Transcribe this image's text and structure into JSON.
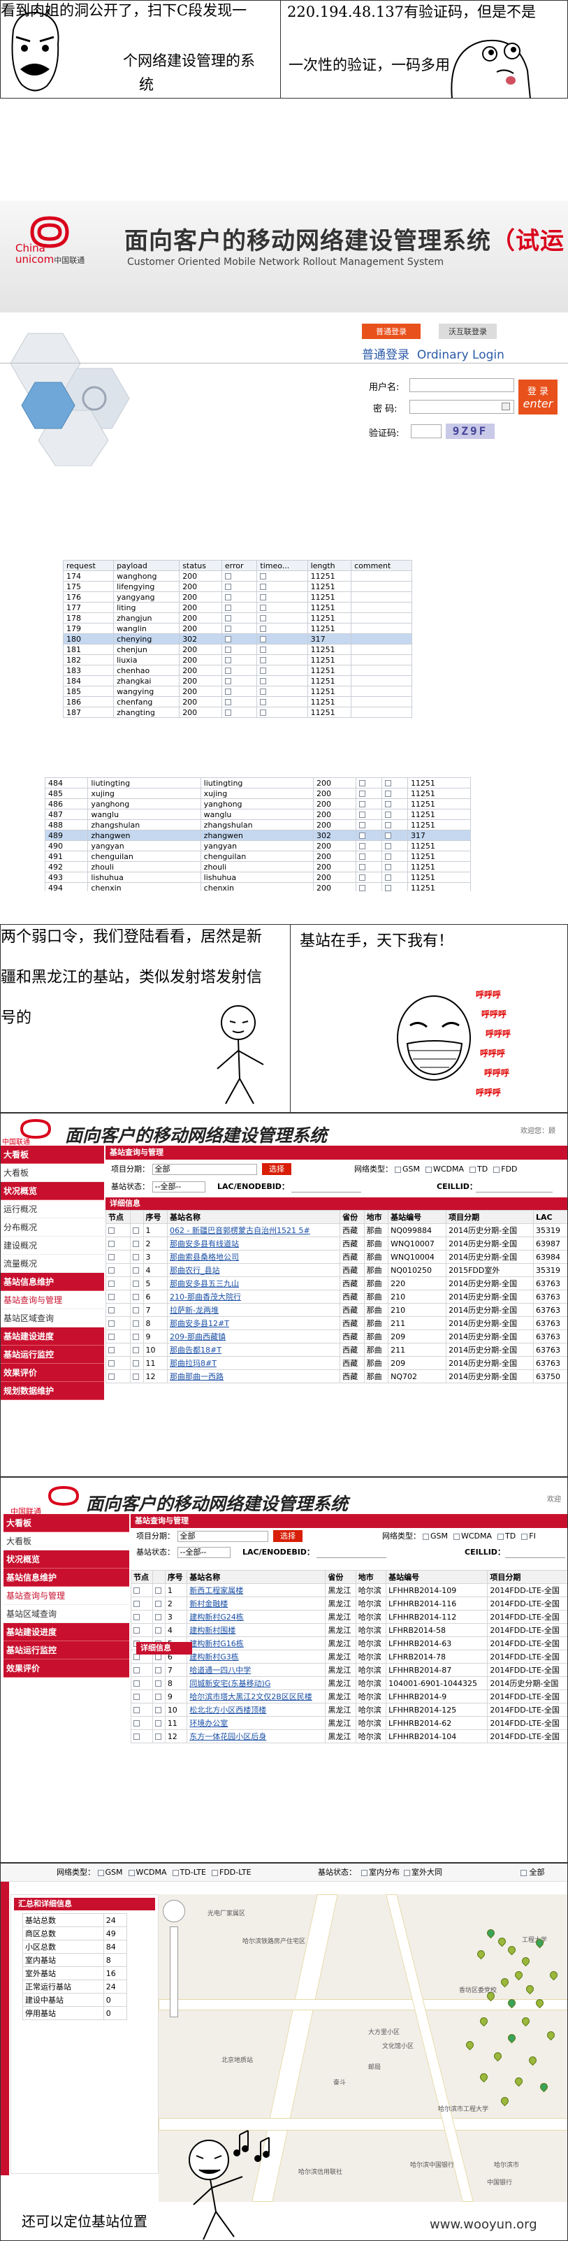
{
  "comic1": {
    "left_text": "看到肉姐的洞公开了，扫下C段发现一个网络建设管理的系统",
    "left_line1": "看到肉姐的洞公开了，扫下C段发现一",
    "left_line2": "个网络建设管理的系",
    "left_line3": "统",
    "right_line1": "220.194.48.137有验证码，但是不是",
    "right_line2": "一次性的验证，一码多用"
  },
  "login": {
    "logo_cn": "中国联通",
    "logo_en_top": "China",
    "logo_en_bottom": "unicom",
    "system_title": "面向客户的移动网络建设管理系统",
    "system_title_suffix": "（试运",
    "system_subtitle": "Customer Oriented Mobile Network Rollout Management System",
    "tab_active": "普通登录",
    "tab_other": "沃互联登录",
    "login_heading_cn": "普通登录",
    "login_heading_en": "Ordinary Login",
    "user_label": "用户名:",
    "pass_label": "密  码:",
    "captcha_label": "验证码:",
    "captcha_value": "9Z9F",
    "login_btn_cn": "登 录",
    "login_btn_en": "enter"
  },
  "burp1": {
    "headers": [
      "request",
      "payload",
      "status",
      "error",
      "timeo...",
      "length",
      "comment"
    ],
    "rows": [
      [
        "174",
        "wanghong",
        "200",
        "",
        "",
        "11251",
        ""
      ],
      [
        "175",
        "lifengying",
        "200",
        "",
        "",
        "11251",
        ""
      ],
      [
        "176",
        "yangyang",
        "200",
        "",
        "",
        "11251",
        ""
      ],
      [
        "177",
        "liting",
        "200",
        "",
        "",
        "11251",
        ""
      ],
      [
        "178",
        "zhangjun",
        "200",
        "",
        "",
        "11251",
        ""
      ],
      [
        "179",
        "wanglin",
        "200",
        "",
        "",
        "11251",
        ""
      ],
      [
        "180",
        "chenying",
        "302",
        "",
        "",
        "317",
        ""
      ],
      [
        "181",
        "chenjun",
        "200",
        "",
        "",
        "11251",
        ""
      ],
      [
        "182",
        "liuxia",
        "200",
        "",
        "",
        "11251",
        ""
      ],
      [
        "183",
        "chenhao",
        "200",
        "",
        "",
        "11251",
        ""
      ],
      [
        "184",
        "zhangkai",
        "200",
        "",
        "",
        "11251",
        ""
      ],
      [
        "185",
        "wangying",
        "200",
        "",
        "",
        "11251",
        ""
      ],
      [
        "186",
        "chenfang",
        "200",
        "",
        "",
        "11251",
        ""
      ],
      [
        "187",
        "zhangting",
        "200",
        "",
        "",
        "11251",
        ""
      ]
    ],
    "selected_index": 6
  },
  "burp2": {
    "rows": [
      [
        "484",
        "liutingting",
        "liutingting",
        "200",
        "",
        "",
        "11251"
      ],
      [
        "485",
        "xujing",
        "xujing",
        "200",
        "",
        "",
        "11251"
      ],
      [
        "486",
        "yanghong",
        "yanghong",
        "200",
        "",
        "",
        "11251"
      ],
      [
        "487",
        "wanglu",
        "wanglu",
        "200",
        "",
        "",
        "11251"
      ],
      [
        "488",
        "zhangshulan",
        "zhangshulan",
        "200",
        "",
        "",
        "11251"
      ],
      [
        "489",
        "zhangwen",
        "zhangwen",
        "302",
        "",
        "",
        "317"
      ],
      [
        "490",
        "yangyan",
        "yangyan",
        "200",
        "",
        "",
        "11251"
      ],
      [
        "491",
        "chenguilan",
        "chenguilan",
        "200",
        "",
        "",
        "11251"
      ],
      [
        "492",
        "zhouli",
        "zhouli",
        "200",
        "",
        "",
        "11251"
      ],
      [
        "493",
        "lishuhua",
        "lishuhua",
        "200",
        "",
        "",
        "11251"
      ],
      [
        "494",
        "chenxin",
        "chenxin",
        "200",
        "",
        "",
        "11251"
      ]
    ],
    "selected_index": 5
  },
  "comic2": {
    "left_line1": "两个弱口令，我们登陆看看，居然是新",
    "left_line2": "疆和黑龙江的基站，类似发射塔发射信",
    "left_line3": "号的",
    "right_line1": "基站在手，天下我有！",
    "laugh": [
      "呼呼呼",
      "呼呼呼",
      "呼呼呼",
      "呼呼呼",
      "呼呼呼",
      "呼呼呼"
    ]
  },
  "sys1": {
    "title": "面向客户的移动网络建设管理系统",
    "welcome": "欢迎您：顾",
    "sidebar": [
      "大看板",
      "大看板",
      "状况概览",
      "运行概况",
      "分布概况",
      "建设概况",
      "流量概况",
      "基站信息维护",
      "基站查询与管理",
      "基站区域查询",
      "基站建设进度",
      "基站运行监控",
      "效果评价",
      "规划数据维护"
    ],
    "panel_title": "基站查询与管理",
    "project_label": "项目分期：",
    "project_value": "全部",
    "select_btn": "选择",
    "net_label": "网络类型：",
    "net_types": [
      "GSM",
      "WCDMA",
      "TD",
      "FDD"
    ],
    "state_label": "基站状态：",
    "state_value": "--全部--",
    "lac_label": "LAC/ENODEBID：",
    "cell_label": "CEILLID：",
    "detail_title": "详细信息",
    "headers": [
      "节点",
      "",
      "序号",
      "基站名称",
      "省份",
      "地市",
      "基站编号",
      "项目分期",
      "LAC"
    ],
    "rows": [
      [
        "1",
        "062 - 新疆巴音郭楞蒙古自治州1521 5#",
        "西藏",
        "那曲",
        "NQ099884",
        "2014历史分期-全国",
        "35319"
      ],
      [
        "2",
        "那曲安多县有线道站",
        "西藏",
        "那曲",
        "WNQ10007",
        "2014历史分期-全国",
        "63987"
      ],
      [
        "3",
        "那曲索县桑格地公司",
        "西藏",
        "那曲",
        "WNQ10004",
        "2014历史分期-全国",
        "63984"
      ],
      [
        "4",
        "那曲农行_县站",
        "西藏",
        "那曲",
        "NQ010250",
        "2015FDD室外",
        "35319"
      ],
      [
        "5",
        "那曲安多县五三九山",
        "西藏",
        "那曲",
        "220",
        "2014历史分期-全国",
        "63763"
      ],
      [
        "6",
        "210-那曲香茂大院行",
        "西藏",
        "那曲",
        "210",
        "2014历史分期-全国",
        "63763"
      ],
      [
        "7",
        "拉萨新-龙两堆",
        "西藏",
        "那曲",
        "210",
        "2014历史分期-全国",
        "63763"
      ],
      [
        "8",
        "那曲安多县12#T",
        "西藏",
        "那曲",
        "211",
        "2014历史分期-全国",
        "63763"
      ],
      [
        "9",
        "209-那曲西藏镇",
        "西藏",
        "那曲",
        "209",
        "2014历史分期-全国",
        "63763"
      ],
      [
        "10",
        "那曲告都18#T",
        "西藏",
        "那曲",
        "211",
        "2014历史分期-全国",
        "63763"
      ],
      [
        "11",
        "那曲拉玛8#T",
        "西藏",
        "那曲",
        "209",
        "2014历史分期-全国",
        "63763"
      ],
      [
        "12",
        "那曲那曲一西路",
        "西藏",
        "那曲",
        "NQ702",
        "2014历史分期-全国",
        "63750"
      ]
    ]
  },
  "sys2": {
    "title": "面向客户的移动网络建设管理系统",
    "welcome": "欢迎",
    "sidebar": [
      "大看板",
      "大看板",
      "状况概览",
      "基站信息维护",
      "基站查询与管理",
      "基站区域查询",
      "基站建设进度",
      "基站运行监控",
      "效果评价"
    ],
    "panel_title": "基站查询与管理",
    "project_label": "项目分期：",
    "project_value": "全部",
    "select_btn": "选择",
    "net_label": "网络类型：",
    "net_types": [
      "GSM",
      "WCDMA",
      "TD",
      "FI"
    ],
    "state_label": "基站状态：",
    "state_value": "--全部--",
    "lac_label": "LAC/ENODEBID：",
    "cell_label": "CEILLID：",
    "detail_title": "详细信息",
    "headers": [
      "节点",
      "",
      "序号",
      "基站名称",
      "省份",
      "地市",
      "基站编号",
      "项目分期"
    ],
    "rows": [
      [
        "1",
        "新西工程家属楼",
        "黑龙江",
        "哈尔滨",
        "LFHHRB2014-109",
        "2014FDD-LTE-全国"
      ],
      [
        "2",
        "新村金融楼",
        "黑龙江",
        "哈尔滨",
        "LFHHRB2014-116",
        "2014FDD-LTE-全国"
      ],
      [
        "3",
        "建构新村G24栋",
        "黑龙江",
        "哈尔滨",
        "LFHHRB2014-112",
        "2014FDD-LTE-全国"
      ],
      [
        "4",
        "建构新村围楼",
        "黑龙江",
        "哈尔滨",
        "LFHRB2014-58",
        "2014FDD-LTE-全国"
      ],
      [
        "5",
        "建构新村G16栋",
        "黑龙江",
        "哈尔滨",
        "LFHHRB2014-63",
        "2014FDD-LTE-全国"
      ],
      [
        "6",
        "建构新村G3栋",
        "黑龙江",
        "哈尔滨",
        "LFHRB2014-78",
        "2014FDD-LTE-全国"
      ],
      [
        "7",
        "哈道通一四八中学",
        "黑龙江",
        "哈尔滨",
        "LFHHRB2014-87",
        "2014FDD-LTE-全国"
      ],
      [
        "8",
        "同城新安宅(东基移动)G",
        "黑龙江",
        "哈尔滨",
        "104001-6901-1044325",
        "2014历史分期-全国"
      ],
      [
        "9",
        "哈尔滨市塔大黑江2文仅2B区区民楼",
        "黑龙江",
        "哈尔滨",
        "LFHHRB2014-9",
        "2014FDD-LTE-全国"
      ],
      [
        "10",
        "松北北方小区西楼顶楼",
        "黑龙江",
        "哈尔滨",
        "LFHHRB2014-125",
        "2014FDD-LTE-全国"
      ],
      [
        "11",
        "环境办公室",
        "黑龙江",
        "哈尔滨",
        "LFHHRB2014-62",
        "2014FDD-LTE-全国"
      ],
      [
        "12",
        "东方一体花园小区后身",
        "黑龙江",
        "哈尔滨",
        "LFHHRB2014-104",
        "2014FDD-LTE-全国"
      ]
    ]
  },
  "mapview": {
    "net_label": "网络类型：",
    "net_types": [
      "GSM",
      "WCDMA",
      "TD-LTE",
      "FDD-LTE"
    ],
    "state_label": "基站状态：",
    "state_opts": [
      "室内分布",
      "室外大同"
    ],
    "all_label": "全部",
    "summary_title": "汇总和详细信息",
    "summary": [
      [
        "基站总数",
        "24"
      ],
      [
        "商区总数",
        "49"
      ],
      [
        "小区总数",
        "84"
      ],
      [
        "室内基站",
        "8"
      ],
      [
        "室外基站",
        "16"
      ],
      [
        "正常运行基站",
        "24"
      ],
      [
        "建设中基站",
        "0"
      ],
      [
        "停用基站",
        "0"
      ]
    ],
    "map_labels": [
      "光电厂家属区",
      "哈尔滨铁路房产住宅区",
      "大方里小区",
      "文化馆小区",
      "邮局",
      "奋斗",
      "香坊区委党校",
      "工程大学",
      "北京地质站",
      "哈尔滨市工程大学",
      "哈尔滨中国银行",
      "哈尔滨市",
      "哈尔滨信用联社",
      "中国银行"
    ]
  },
  "comic3": {
    "caption": "还可以定位基站位置",
    "watermark": "www.wooyun.org"
  },
  "colors": {
    "unicom_red": "#c8102e",
    "burp_selected": "#c5d8f0",
    "link_blue": "#1a4fa5"
  }
}
